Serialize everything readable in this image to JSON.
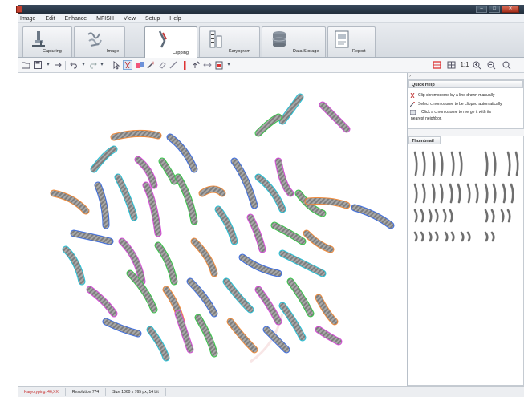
{
  "window": {
    "title": "",
    "buttons": {
      "minimize": "–",
      "maximize": "□",
      "close": "✕"
    }
  },
  "menu": [
    "Image",
    "Edit",
    "Enhance",
    "MFISH",
    "View",
    "Setup",
    "Help"
  ],
  "modules": [
    {
      "label": "Capturing",
      "icon": "microscope-icon"
    },
    {
      "label": "Image",
      "icon": "image-icon"
    },
    {
      "label": "Clipping",
      "icon": "scissors-icon",
      "active": true
    },
    {
      "label": "Karyogram",
      "icon": "karyogram-icon"
    },
    {
      "label": "Data Storage",
      "icon": "database-icon"
    },
    {
      "label": "Report",
      "icon": "report-icon"
    }
  ],
  "toolbar": {
    "left": [
      "open-icon",
      "save-icon",
      "transfer-icon",
      "undo-icon",
      "redo-icon",
      "select-icon",
      "clip-icon",
      "merge-icon",
      "auto-clip-icon",
      "eraser-icon",
      "draw-line-icon",
      "separator-icon",
      "rotate-icon",
      "flip-icon",
      "export-icon"
    ],
    "right": {
      "zoom_ratio": "1:1"
    }
  },
  "quick_help": {
    "title": "Quick Help",
    "lines": [
      "Clip chromosome by a line drawn manually",
      "Select chromosome to be clipped automatically",
      "Click a chromosome to merge it with its",
      "nearest neighbor."
    ]
  },
  "thumbnail": {
    "title": "Thumbnail"
  },
  "status": {
    "mode": "Karyotyping: 46,XX",
    "resolution": "Resolution 774",
    "size": "Size 1060 x 765 px, 14 bit"
  },
  "colors": {
    "accent": "#2f6fc0",
    "status_red": "#c62828",
    "outline_cyan": "#27c3d8",
    "outline_magenta": "#d64bd8",
    "outline_green": "#38c84a",
    "outline_orange": "#f08a3a",
    "outline_blue": "#3f6fe0"
  }
}
